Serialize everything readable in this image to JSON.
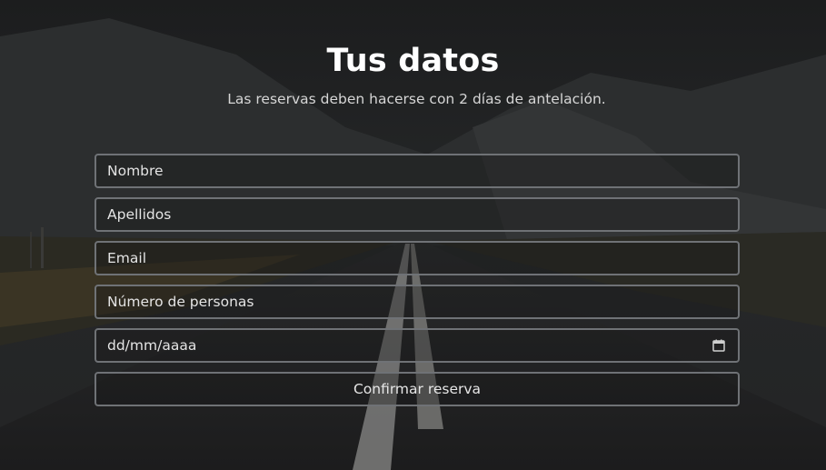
{
  "header": {
    "title": "Tus datos",
    "subtitle": "Las reservas deben hacerse con 2 días de antelación."
  },
  "form": {
    "fields": [
      {
        "placeholder": "Nombre"
      },
      {
        "placeholder": "Apellidos"
      },
      {
        "placeholder": "Email"
      },
      {
        "placeholder": "Número de personas"
      },
      {
        "placeholder": "dd/mm/aaaa",
        "icon": "calendar-icon"
      }
    ],
    "submit_label": "Confirmar reserva"
  },
  "colors": {
    "background": "#1e1f20",
    "text": "#ffffff",
    "border": "#6f7276"
  }
}
